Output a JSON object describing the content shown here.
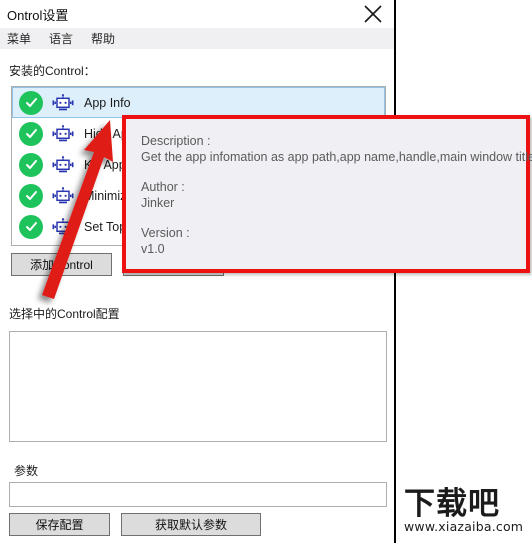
{
  "window": {
    "title": "Ontrol设置",
    "close_icon": "close-icon"
  },
  "menu": {
    "items": [
      {
        "label": "菜单"
      },
      {
        "label": "语言"
      },
      {
        "label": "帮助"
      }
    ]
  },
  "labels": {
    "installed_controls": "安装的Control：",
    "selected_config": "选择中的Control配置",
    "parameters": "参数"
  },
  "control_list": {
    "rows": [
      {
        "label": "App Info",
        "status_icon": "check-circle-icon",
        "type_icon": "bot-icon",
        "selected": true
      },
      {
        "label": "Hide App",
        "status_icon": "check-circle-icon",
        "type_icon": "bot-icon",
        "selected": false
      },
      {
        "label": "Kill App",
        "status_icon": "check-circle-icon",
        "type_icon": "bot-icon",
        "selected": false
      },
      {
        "label": "Minimize App",
        "status_icon": "check-circle-icon",
        "type_icon": "bot-icon",
        "selected": false
      },
      {
        "label": "Set Top Most",
        "status_icon": "check-circle-icon",
        "type_icon": "bot-icon",
        "selected": false
      }
    ]
  },
  "buttons": {
    "add_control": "添加Control",
    "delete_control": "",
    "save_config": "保存配置",
    "get_default_params": "获取默认参数"
  },
  "fields": {
    "config_value": "",
    "config_placeholder": "",
    "param_value": "",
    "param_placeholder": ""
  },
  "tooltip": {
    "description_label": "Description :",
    "description_value": "Get the app infomation as app path,app name,handle,main window title...",
    "author_label": "Author :",
    "author_value": "Jinker",
    "version_label": "Version :",
    "version_value": "v1.0",
    "border_color": "#ee1111",
    "background_color": "#f0f0f4"
  },
  "annotation": {
    "arrow_color": "#e01b17",
    "arrow_name": "red-arrow-annotation"
  },
  "watermark": {
    "brand": "下载吧",
    "url": "www.xiazaiba.com"
  },
  "colors": {
    "check_green": "#1ec35c",
    "bot_blue": "#2a36b0",
    "selection_blue": "#ddeffb",
    "button_face": "#dcdcdc"
  }
}
